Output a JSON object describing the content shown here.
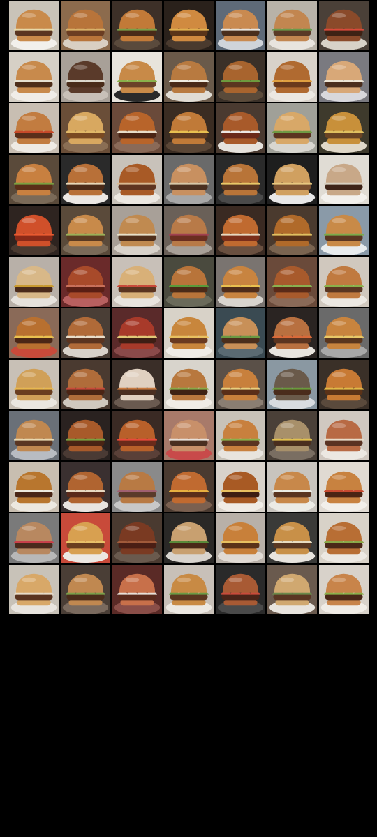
{
  "mosaic": {
    "columns": 7,
    "rows": 12,
    "subject": "burger",
    "tiles": [
      {
        "bg": "#c9c3b8",
        "plate": "#f2f0ec",
        "bun": "#c98a4a",
        "meat": "#5a3520",
        "filling": "#e8d9a8"
      },
      {
        "bg": "#8c6b4d",
        "plate": "#d9cfc2",
        "bun": "#b8743a",
        "meat": "#6b3d22",
        "filling": "#d9b26a"
      },
      {
        "bg": "#3d3028",
        "plate": "#5a4a3c",
        "bun": "#c27a38",
        "meat": "#4a2a18",
        "filling": "#7aa04a"
      },
      {
        "bg": "#2a211b",
        "plate": "#4a3a2e",
        "bun": "#d08a40",
        "meat": "#5a3418",
        "filling": "#e0b050"
      },
      {
        "bg": "#5e6a78",
        "plate": "#cfd4da",
        "bun": "#c98a50",
        "meat": "#4a2e1c",
        "filling": "#e8e4dc"
      },
      {
        "bg": "#b8b2a8",
        "plate": "#e8e4de",
        "bun": "#c28650",
        "meat": "#5a3a26",
        "filling": "#6a9a4a"
      },
      {
        "bg": "#4a4038",
        "plate": "#d8d2c8",
        "bun": "#8a4a2a",
        "meat": "#3e2214",
        "filling": "#d84a3a"
      },
      {
        "bg": "#d6d0c6",
        "plate": "#f0ede8",
        "bun": "#c88a4c",
        "meat": "#4e2e1a",
        "filling": "#e6e0d0"
      },
      {
        "bg": "#a8a098",
        "plate": "#c8c0b8",
        "bun": "#5a3a2a",
        "meat": "#4a2c1a",
        "filling": "#dcd8cc"
      },
      {
        "bg": "#e8e4dc",
        "plate": "#2a2a2a",
        "bun": "#c88a48",
        "meat": "#6a4228",
        "filling": "#8ab04a"
      },
      {
        "bg": "#6a5a4a",
        "plate": "#e0dcd4",
        "bun": "#b87a40",
        "meat": "#4a2a18",
        "filling": "#f0ece0"
      },
      {
        "bg": "#3a3028",
        "plate": "#5a4a3a",
        "bun": "#a8642e",
        "meat": "#5a3620",
        "filling": "#6e9a3e"
      },
      {
        "bg": "#d8d2ca",
        "plate": "#ece8e2",
        "bun": "#b06a30",
        "meat": "#6a3a1c",
        "filling": "#e0a040"
      },
      {
        "bg": "#7a7a80",
        "plate": "#d8d8dc",
        "bun": "#d8a878",
        "meat": "#4a2e1e",
        "filling": "#ece4d4"
      },
      {
        "bg": "#c8beb2",
        "plate": "#eeeae4",
        "bun": "#c27c40",
        "meat": "#5a2e1a",
        "filling": "#c84a2a"
      },
      {
        "bg": "#6a4e38",
        "plate": "#8a6e54",
        "bun": "#d8a860",
        "meat": "#7a4a22",
        "filling": "#e0b868"
      },
      {
        "bg": "#6a4a3a",
        "plate": "#8a6a58",
        "bun": "#b8642a",
        "meat": "#4a2414",
        "filling": "#e8dcc8"
      },
      {
        "bg": "#3a2c22",
        "plate": "#5a4636",
        "bun": "#c07a38",
        "meat": "#5e3a20",
        "filling": "#e8c050"
      },
      {
        "bg": "#4a3a30",
        "plate": "#e6e2dc",
        "bun": "#a85a2a",
        "meat": "#6a2a1a",
        "filling": "#ece8e4"
      },
      {
        "bg": "#a0a098",
        "plate": "#d8d6d0",
        "bun": "#d8a868",
        "meat": "#5a3420",
        "filling": "#6e9a44"
      },
      {
        "bg": "#3e3a2c",
        "plate": "#e0d8c8",
        "bun": "#c8903a",
        "meat": "#6a4424",
        "filling": "#e0c060"
      },
      {
        "bg": "#5a4a3a",
        "plate": "#7a6a58",
        "bun": "#c88040",
        "meat": "#5a2e18",
        "filling": "#7aa040"
      },
      {
        "bg": "#2a2a2a",
        "plate": "#ece8e4",
        "bun": "#b87038",
        "meat": "#4a2a18",
        "filling": "#e8d8b8"
      },
      {
        "bg": "#c8c2ba",
        "plate": "#ebe7e1",
        "bun": "#a85a26",
        "meat": "#5e3420",
        "filling": "#d8b890"
      },
      {
        "bg": "#6a6a6a",
        "plate": "#a8a8a8",
        "bun": "#c89060",
        "meat": "#4a3020",
        "filling": "#d8c8a8"
      },
      {
        "bg": "#2a2a2a",
        "plate": "#4a4a4a",
        "bun": "#b87438",
        "meat": "#5a3620",
        "filling": "#e8c868"
      },
      {
        "bg": "#1e1e1e",
        "plate": "#e8e8e8",
        "bun": "#d0a060",
        "meat": "#7a5030",
        "filling": "#e8c880"
      },
      {
        "bg": "#e0dcd4",
        "plate": "#f2f0ec",
        "bun": "#c8a888",
        "meat": "#3e2418",
        "filling": "#d8d0c0"
      },
      {
        "bg": "#2e2420",
        "plate": "#4a3a30",
        "bun": "#d0502a",
        "meat": "#8a2a18",
        "filling": "#e85a30"
      },
      {
        "bg": "#5a4a3a",
        "plate": "#7a6a58",
        "bun": "#c88a4a",
        "meat": "#5a3a22",
        "filling": "#9ab058"
      },
      {
        "bg": "#a8a098",
        "plate": "#d8d2ca",
        "bun": "#c08a50",
        "meat": "#4e2e1a",
        "filling": "#e8e0c8"
      },
      {
        "bg": "#6a6058",
        "plate": "#a8a098",
        "bun": "#b87a48",
        "meat": "#6a2e20",
        "filling": "#a04050"
      },
      {
        "bg": "#3a2a22",
        "plate": "#6a5040",
        "bun": "#c06a30",
        "meat": "#7a2e1a",
        "filling": "#e8d8c0"
      },
      {
        "bg": "#4a3a2e",
        "plate": "#7a6450",
        "bun": "#b06a2a",
        "meat": "#5a3218",
        "filling": "#e0c060"
      },
      {
        "bg": "#8a9aa8",
        "plate": "#e8ecee",
        "bun": "#c88a48",
        "meat": "#5a3622",
        "filling": "#7aaa4a"
      },
      {
        "bg": "#b8b0a8",
        "plate": "#e6e2dc",
        "bun": "#d8b888",
        "meat": "#4a2a1a",
        "filling": "#c89a30"
      },
      {
        "bg": "#6a2a2a",
        "plate": "#b86060",
        "bun": "#a84a2a",
        "meat": "#5a1e14",
        "filling": "#c8705a"
      },
      {
        "bg": "#c8c0b8",
        "plate": "#e8e4de",
        "bun": "#d8b078",
        "meat": "#5a3420",
        "filling": "#c84a3a"
      },
      {
        "bg": "#4a4a3e",
        "plate": "#6a6a5a",
        "bun": "#b8743a",
        "meat": "#4a2a18",
        "filling": "#5a9a3a"
      },
      {
        "bg": "#7a7470",
        "plate": "#d8d4ce",
        "bun": "#c88440",
        "meat": "#4e2c1a",
        "filling": "#e8c050"
      },
      {
        "bg": "#6a4a3a",
        "plate": "#8a6a58",
        "bun": "#a85a2c",
        "meat": "#5a2a18",
        "filling": "#8ab050"
      },
      {
        "bg": "#d0c8be",
        "plate": "#ece8e2",
        "bun": "#c07a40",
        "meat": "#5a3622",
        "filling": "#8ab04a"
      },
      {
        "bg": "#8a6a58",
        "plate": "#c84a3a",
        "bun": "#b87030",
        "meat": "#4a2616",
        "filling": "#e8c050"
      },
      {
        "bg": "#4a3e36",
        "plate": "#d8d2ca",
        "bun": "#b06a38",
        "meat": "#5a3420",
        "filling": "#e8dcc8"
      },
      {
        "bg": "#5a2a2a",
        "plate": "#8a4a4a",
        "bun": "#a83a2a",
        "meat": "#3e1e14",
        "filling": "#e0c878"
      },
      {
        "bg": "#d8d2c8",
        "plate": "#f0ece6",
        "bun": "#c8863c",
        "meat": "#6a3a20",
        "filling": "#e8c060"
      },
      {
        "bg": "#3a4a52",
        "plate": "#5a6a72",
        "bun": "#c89058",
        "meat": "#4a2e1c",
        "filling": "#6a9a44"
      },
      {
        "bg": "#2a2422",
        "plate": "#e8e4de",
        "bun": "#b87040",
        "meat": "#5a3420",
        "filling": "#d86a3a"
      },
      {
        "bg": "#6a6a6a",
        "plate": "#a8a8a8",
        "bun": "#c8843e",
        "meat": "#5a361e",
        "filling": "#e8c868"
      },
      {
        "bg": "#c8c0b6",
        "plate": "#eae6e0",
        "bun": "#d0a058",
        "meat": "#6a3e20",
        "filling": "#e8b850"
      },
      {
        "bg": "#4a3a30",
        "plate": "#d0c8be",
        "bun": "#b06c3a",
        "meat": "#4a2414",
        "filling": "#c84a3a"
      },
      {
        "bg": "#3a2e28",
        "plate": "#6a5a50",
        "bun": "#e0d0c0",
        "meat": "#4a2e20",
        "filling": "#c87a40"
      },
      {
        "bg": "#d8d4cc",
        "plate": "#f0ece6",
        "bun": "#b8783e",
        "meat": "#3e2214",
        "filling": "#8aa848"
      },
      {
        "bg": "#5a5048",
        "plate": "#8a7e72",
        "bun": "#c8803c",
        "meat": "#5a2e18",
        "filling": "#e8d080"
      },
      {
        "bg": "#8a98a2",
        "plate": "#d8dce0",
        "bun": "#6a5a4a",
        "meat": "#4a2c1c",
        "filling": "#6a9a3c"
      },
      {
        "bg": "#3a3028",
        "plate": "#5a4a3c",
        "bun": "#c87a34",
        "meat": "#5a3218",
        "filling": "#e0b848"
      },
      {
        "bg": "#6a7078",
        "plate": "#b8bcc2",
        "bun": "#c08850",
        "meat": "#5a3622",
        "filling": "#e8d8b0"
      },
      {
        "bg": "#2a2220",
        "plate": "#4a3a34",
        "bun": "#a85a2a",
        "meat": "#4a2414",
        "filling": "#7aa040"
      },
      {
        "bg": "#3a2a24",
        "plate": "#5a4038",
        "bun": "#b8602a",
        "meat": "#6a2a1a",
        "filling": "#e84a3a"
      },
      {
        "bg": "#a87a6a",
        "plate": "#c84a4a",
        "bun": "#c8906a",
        "meat": "#4a2e20",
        "filling": "#e8e0d8"
      },
      {
        "bg": "#c8c2b8",
        "plate": "#e8e4de",
        "bun": "#c8803e",
        "meat": "#5a3420",
        "filling": "#8ab04a"
      },
      {
        "bg": "#4a4038",
        "plate": "#7a6e62",
        "bun": "#a8906a",
        "meat": "#4a2e1e",
        "filling": "#e0c050"
      },
      {
        "bg": "#d0c8c0",
        "plate": "#ece8e2",
        "bun": "#b86a44",
        "meat": "#5a3222",
        "filling": "#e8dcc8"
      },
      {
        "bg": "#c8beb0",
        "plate": "#ece8e0",
        "bun": "#b8762e",
        "meat": "#4a2616",
        "filling": "#ece8dc"
      },
      {
        "bg": "#3a3030",
        "plate": "#e8e4e0",
        "bun": "#b06430",
        "meat": "#5a2a1a",
        "filling": "#e8d8c0"
      },
      {
        "bg": "#8a8a8a",
        "plate": "#c8c8c8",
        "bun": "#b87a44",
        "meat": "#5a3a2a",
        "filling": "#a06070"
      },
      {
        "bg": "#4a3a30",
        "plate": "#7a6050",
        "bun": "#c06a30",
        "meat": "#5a2e1a",
        "filling": "#e8b040"
      },
      {
        "bg": "#d8d2ca",
        "plate": "#f0ece6",
        "bun": "#a85a24",
        "meat": "#3e1e12",
        "filling": "#e8c060"
      },
      {
        "bg": "#c8c4be",
        "plate": "#ecebe6",
        "bun": "#c8884a",
        "meat": "#5a3420",
        "filling": "#ecece4"
      },
      {
        "bg": "#e0dad2",
        "plate": "#f2efea",
        "bun": "#c88240",
        "meat": "#4a2414",
        "filling": "#c84a30"
      },
      {
        "bg": "#7a7a7a",
        "plate": "#b8b8b8",
        "bun": "#b88860",
        "meat": "#4a2a1c",
        "filling": "#c8404a"
      },
      {
        "bg": "#c84a3a",
        "plate": "#ece8e2",
        "bun": "#d8a050",
        "meat": "#6a3e1e",
        "filling": "#e8c068"
      },
      {
        "bg": "#4a3a30",
        "plate": "#6a5a4e",
        "bun": "#7a3a22",
        "meat": "#4a1e14",
        "filling": "#a05a3a"
      },
      {
        "bg": "#2a2826",
        "plate": "#d8d4ce",
        "bun": "#c8a070",
        "meat": "#4a2818",
        "filling": "#5a8a3a"
      },
      {
        "bg": "#b8b0a8",
        "plate": "#e0dad4",
        "bun": "#c8803a",
        "meat": "#5a3218",
        "filling": "#e8c060"
      },
      {
        "bg": "#3a3a38",
        "plate": "#e8e4de",
        "bun": "#c89048",
        "meat": "#5a3822",
        "filling": "#e8dcc0"
      },
      {
        "bg": "#d8d2c8",
        "plate": "#ece8e2",
        "bun": "#b86e34",
        "meat": "#4a2818",
        "filling": "#8aa848"
      },
      {
        "bg": "#c8c2b8",
        "plate": "#e8e4de",
        "bun": "#d8a868",
        "meat": "#5a3420",
        "filling": "#e8dcc8"
      },
      {
        "bg": "#4a3e36",
        "plate": "#7a6a5e",
        "bun": "#c08850",
        "meat": "#4a2c1a",
        "filling": "#7aa04a"
      },
      {
        "bg": "#5a2a26",
        "plate": "#8a4e48",
        "bun": "#c8704a",
        "meat": "#5a2a1c",
        "filling": "#e8e0d8"
      },
      {
        "bg": "#c8c0b8",
        "plate": "#ece8e2",
        "bun": "#c88a44",
        "meat": "#5a3620",
        "filling": "#6a9a44"
      },
      {
        "bg": "#2a2a2a",
        "plate": "#4a4a4a",
        "bun": "#a85a34",
        "meat": "#4a2418",
        "filling": "#c84a3a"
      },
      {
        "bg": "#6a5a4e",
        "plate": "#e8e4de",
        "bun": "#d0a870",
        "meat": "#5a3622",
        "filling": "#6a8a4a"
      },
      {
        "bg": "#d8d2ca",
        "plate": "#f0ece6",
        "bun": "#c8844a",
        "meat": "#4a2818",
        "filling": "#8ab04a"
      }
    ]
  }
}
